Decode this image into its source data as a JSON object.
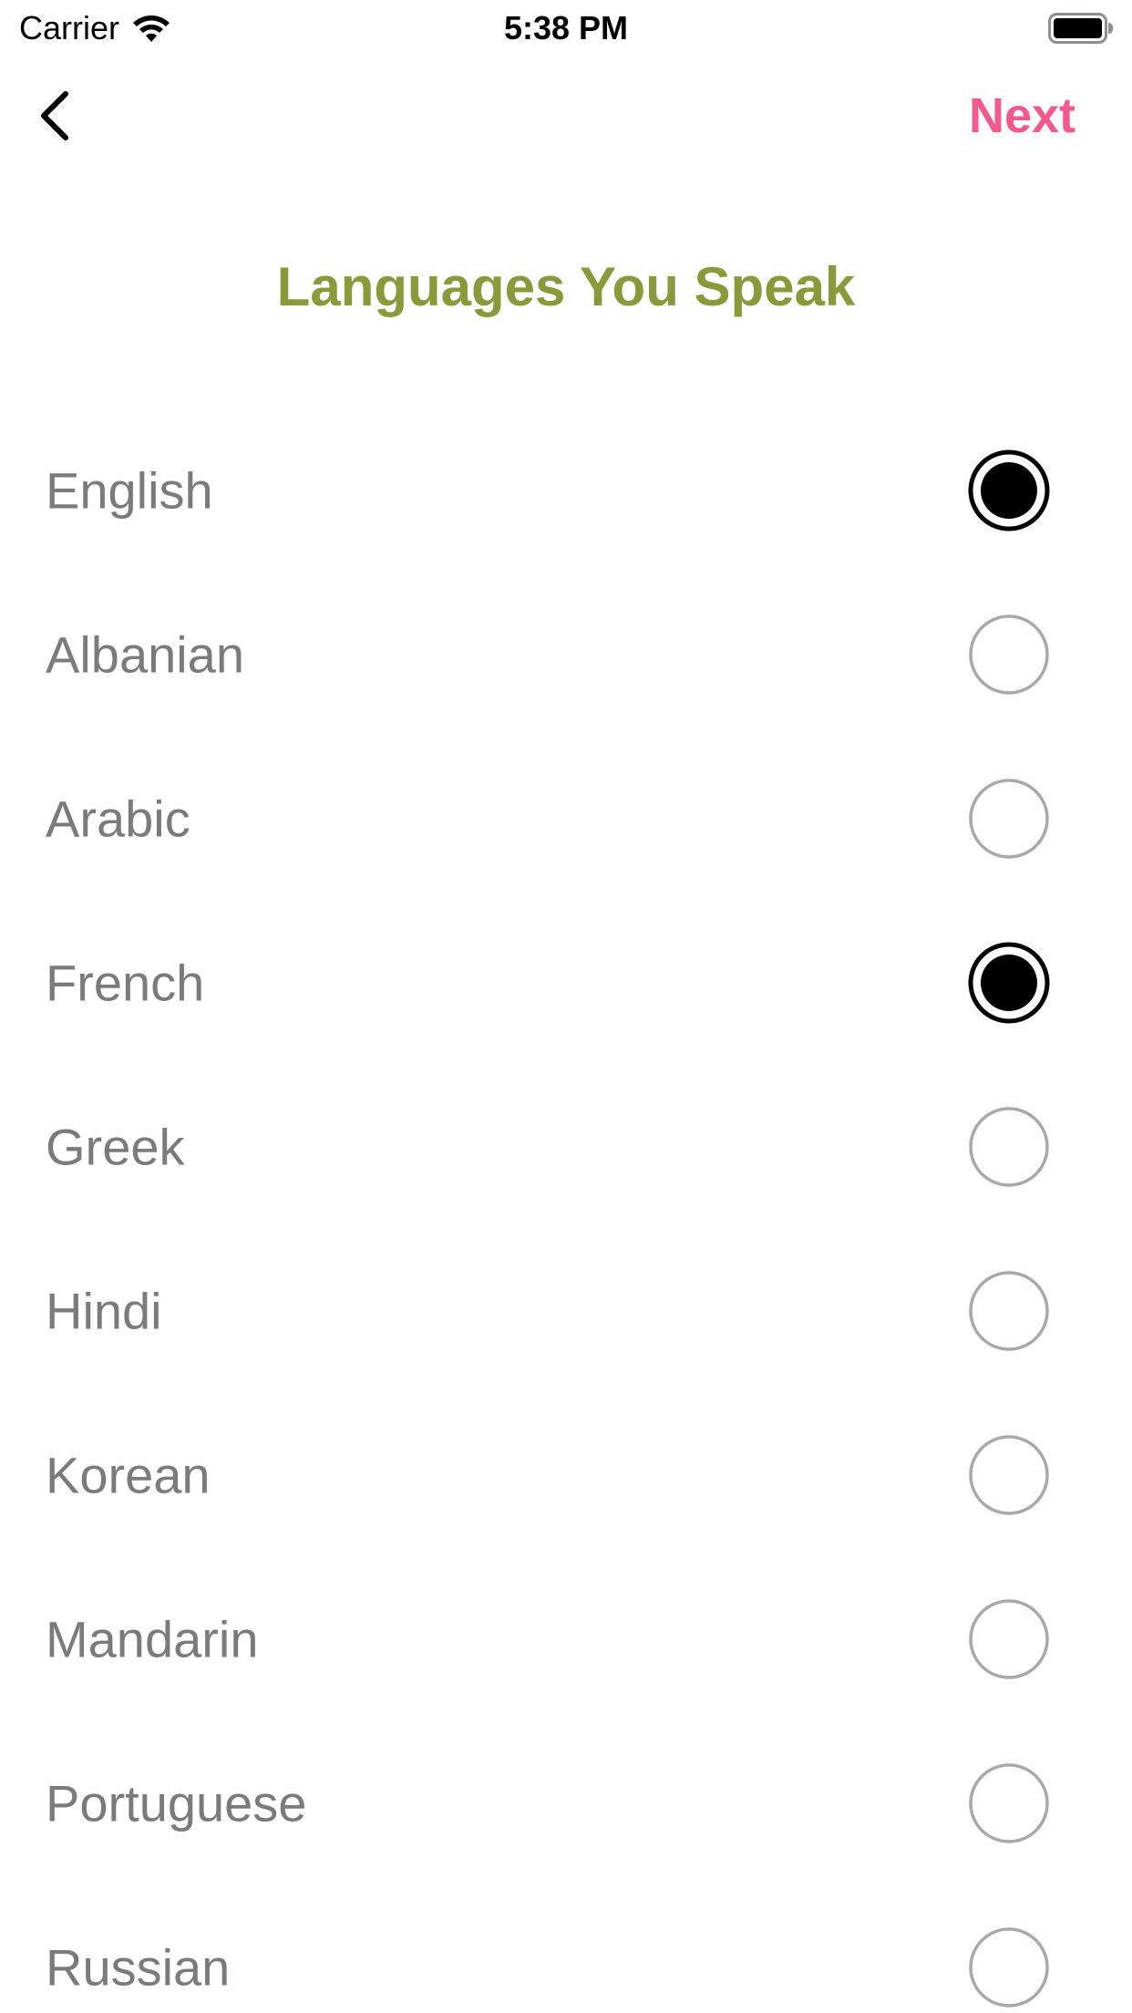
{
  "status_bar": {
    "carrier": "Carrier",
    "wifi_icon": "wifi-icon",
    "time": "5:38 PM",
    "battery_icon": "battery-icon"
  },
  "nav": {
    "back_icon": "chevron-left-icon",
    "next_label": "Next",
    "next_color": "#f15a8a"
  },
  "title": {
    "text": "Languages You Speak",
    "color": "#8a9a3a"
  },
  "languages": [
    {
      "label": "English",
      "selected": true
    },
    {
      "label": "Albanian",
      "selected": false
    },
    {
      "label": "Arabic",
      "selected": false
    },
    {
      "label": "French",
      "selected": true
    },
    {
      "label": "Greek",
      "selected": false
    },
    {
      "label": "Hindi",
      "selected": false
    },
    {
      "label": "Korean",
      "selected": false
    },
    {
      "label": "Mandarin",
      "selected": false
    },
    {
      "label": "Portuguese",
      "selected": false
    },
    {
      "label": "Russian",
      "selected": false
    }
  ]
}
